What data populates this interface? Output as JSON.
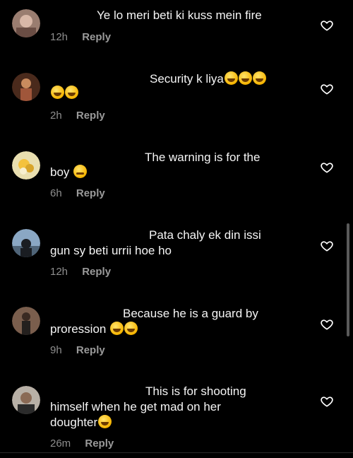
{
  "comments": [
    {
      "text": "Ye lo meri beti ki kuss mein fire",
      "time": "12h",
      "reply": "Reply",
      "avatar": "avatar-blurred-face"
    },
    {
      "text": "Security k liya",
      "emojis": [
        "rolling-on-floor-laughing",
        "rolling-on-floor-laughing",
        "rolling-on-floor-laughing",
        "rolling-on-floor-laughing",
        "rolling-on-floor-laughing"
      ],
      "time": "2h",
      "reply": "Reply",
      "avatar": "avatar-person-warm-light"
    },
    {
      "text_line1": "The warning is for the",
      "text_line2": "boy",
      "emojis": [
        "winking-face"
      ],
      "time": "6h",
      "reply": "Reply",
      "avatar": "avatar-flower-illustration"
    },
    {
      "text_line1": "Pata chaly ek din issi",
      "text_line2": "gun sy beti urrii hoe ho",
      "time": "12h",
      "reply": "Reply",
      "avatar": "avatar-silhouette-sky"
    },
    {
      "text_line1": "Because he is a guard by",
      "text_line2": "proression",
      "emojis": [
        "rolling-on-floor-laughing",
        "rolling-on-floor-laughing"
      ],
      "time": "9h",
      "reply": "Reply",
      "avatar": "avatar-person-standing"
    },
    {
      "text_line1": "This is for shooting",
      "text_line2": "himself when he get mad on her",
      "text_line3": "doughter",
      "emojis": [
        "grinning-squinting-face"
      ],
      "time": "26m",
      "reply": "Reply",
      "avatar": "avatar-man-portrait"
    }
  ],
  "colors": {
    "background": "#000000",
    "text": "#f5f5f5",
    "meta": "#8e8e8e"
  }
}
